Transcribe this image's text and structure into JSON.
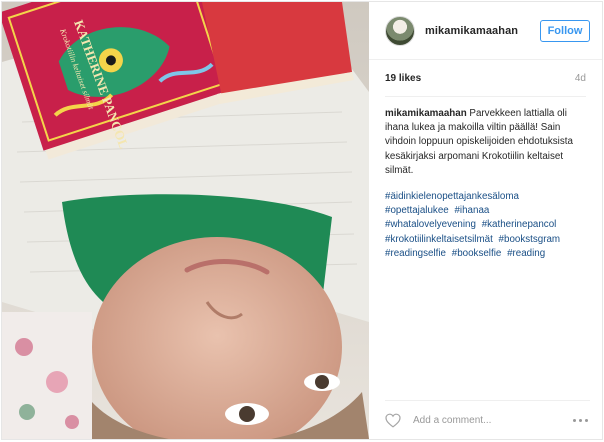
{
  "post": {
    "photo": {
      "book_author": "KATHERINE PANCOL",
      "book_title": "Krokotiilin keltaiset silmät"
    },
    "header": {
      "username": "mikamikamaahan",
      "follow_label": "Follow"
    },
    "stats": {
      "likes": "19 likes",
      "time": "4d"
    },
    "caption": {
      "username": "mikamikamaahan",
      "text": "Parvekkeen lattialla oli ihana lukea ja makoilla viltin päällä! Sain vihdoin loppuun opiskelijoiden ehdotuksista kesäkirjaksi arpomani Krokotiilin keltaiset silmät.",
      "hashtags": [
        "#äidinkielenopettajankesäloma",
        "#opettajalukee",
        "#ihanaa",
        "#whatalovelyevening",
        "#katherinepancol",
        "#krokotiilinkeltaisetsilmät",
        "#bookstsgram",
        "#readingselfie",
        "#bookselfie",
        "#reading"
      ]
    },
    "footer": {
      "comment_placeholder": "Add a comment..."
    },
    "colors": {
      "accent": "#3897f0",
      "hashtag": "#1a4f86",
      "book_cover": "#c8204a"
    },
    "icons": [
      "heart-icon",
      "more-icon"
    ]
  }
}
